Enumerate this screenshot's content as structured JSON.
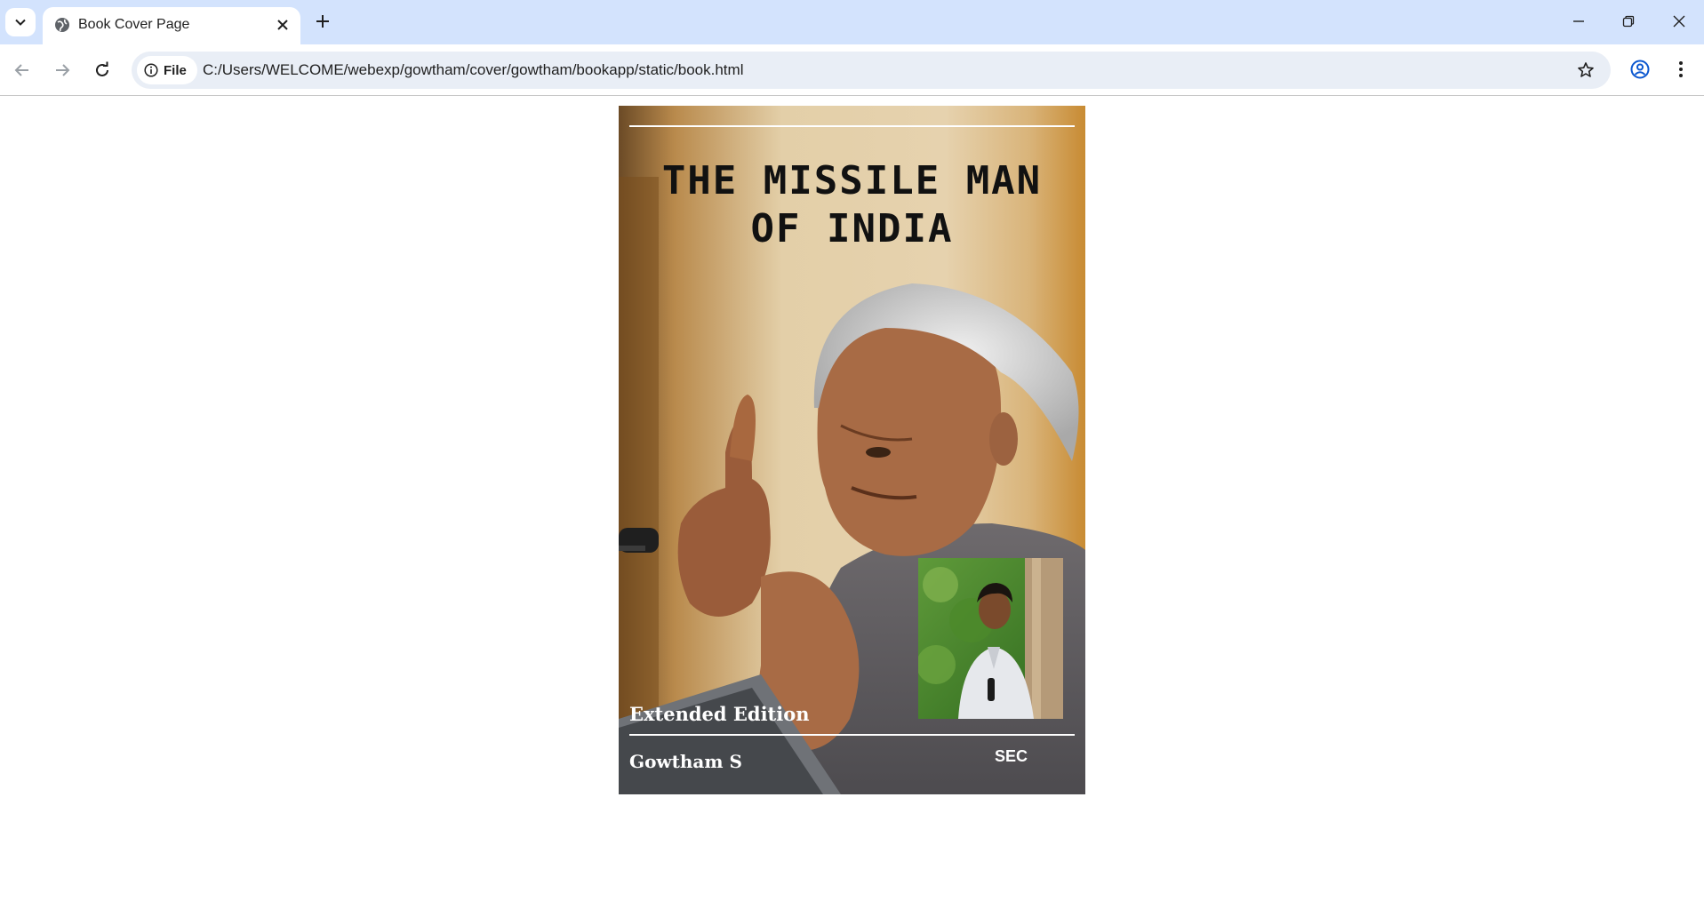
{
  "browser": {
    "tab_title": "Book Cover Page",
    "url_scheme_label": "File",
    "url": "C:/Users/WELCOME/webexp/gowtham/cover/gowtham/bookapp/static/book.html"
  },
  "icons": {
    "tab_search": "chevron-down-icon",
    "favicon": "globe-icon",
    "close_tab": "close-icon",
    "new_tab": "plus-icon",
    "minimize": "minimize-icon",
    "restore": "restore-icon",
    "close_window": "close-icon",
    "back": "arrow-left-icon",
    "forward": "arrow-right-icon",
    "reload": "reload-icon",
    "site_info": "info-icon",
    "bookmark": "star-icon",
    "profile": "account-icon",
    "menu": "kebab-menu-icon"
  },
  "cover": {
    "title": "THE MISSILE MAN\nOF INDIA",
    "edition": "Extended Edition",
    "author": "Gowtham S",
    "publisher": "SEC"
  },
  "colors": {
    "tabbar": "#d3e3fd",
    "omnibox": "#e9eef6",
    "title_text": "#111111",
    "cover_text": "#ffffff"
  }
}
